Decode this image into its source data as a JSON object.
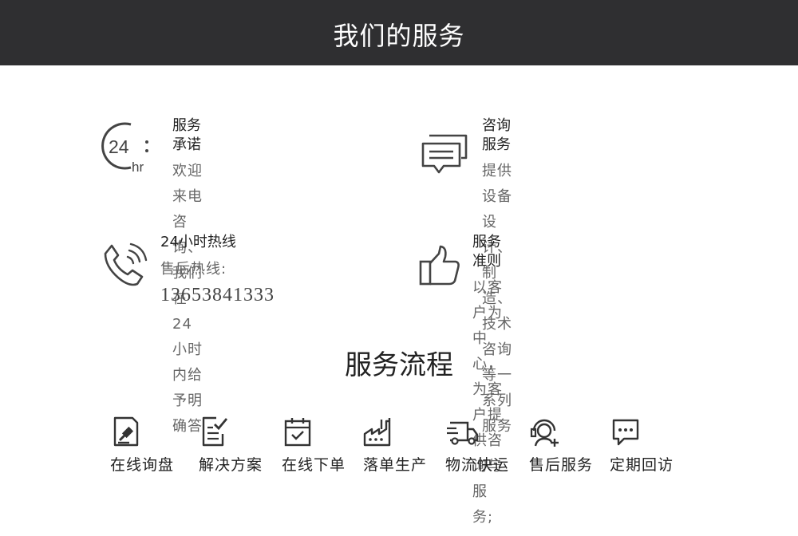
{
  "header": {
    "title": "我们的服务"
  },
  "services": [
    {
      "icon": "24hr-icon",
      "title": "服务承诺",
      "line1": "欢迎来电咨询、我们在",
      "line2": "24小时内给予明确答"
    },
    {
      "icon": "chat-bubbles-icon",
      "title": "咨询服务",
      "line1": "提供设备设计、制造、",
      "line2": "技术咨询等一系列服务"
    },
    {
      "icon": "phone-icon",
      "title": "24小时热线",
      "hotline_label": "售后热线:",
      "hotline_number": "13653841333"
    },
    {
      "icon": "thumbs-up-icon",
      "title": "服务准则",
      "line1": "以客户为中心，为客户提",
      "line2": "供咨询与服务;"
    }
  ],
  "flow": {
    "title": "服务流程",
    "steps": [
      {
        "icon": "inquiry-icon",
        "label": "在线询盘"
      },
      {
        "icon": "solution-doc-icon",
        "label": "解决方案"
      },
      {
        "icon": "calendar-order-icon",
        "label": "在线下单"
      },
      {
        "icon": "factory-icon",
        "label": "落单生产"
      },
      {
        "icon": "delivery-truck-icon",
        "label": "物流快运"
      },
      {
        "icon": "support-agent-icon",
        "label": "售后服务"
      },
      {
        "icon": "message-dots-icon",
        "label": "定期回访"
      }
    ]
  },
  "colors": {
    "header_bg": "#2f2f31",
    "header_text": "#ffffff",
    "icon": "#444444"
  }
}
